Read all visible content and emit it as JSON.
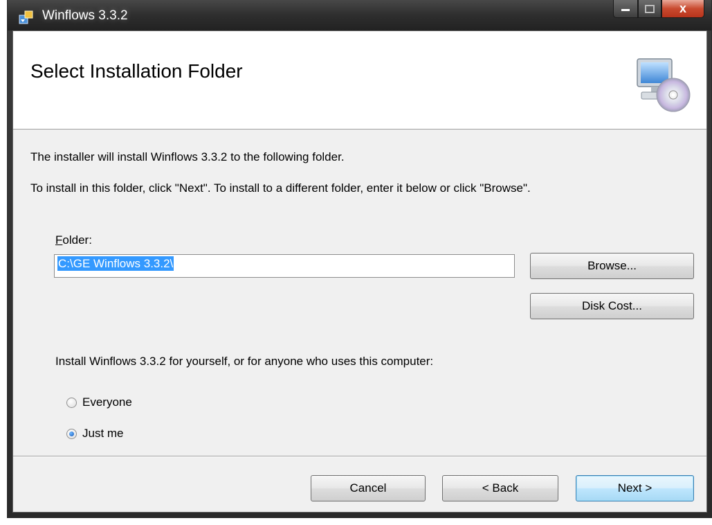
{
  "window": {
    "title": "Winflows 3.3.2",
    "controls": {
      "minimize": "minimize",
      "maximize": "maximize",
      "close": "x"
    }
  },
  "banner": {
    "title": "Select Installation Folder",
    "icon": "computer-cd-icon"
  },
  "messages": {
    "line1": "The installer will install Winflows 3.3.2 to the following folder.",
    "line2": "To install in this folder, click \"Next\". To install to a different folder, enter it below or click \"Browse\"."
  },
  "folder": {
    "label_accel": "F",
    "label_rest": "older:",
    "value": "C:\\GE Winflows 3.3.2\\"
  },
  "buttons": {
    "browse": "Browse...",
    "disk_cost": "Disk Cost...",
    "cancel": "Cancel",
    "back": "< Back",
    "next": "Next >"
  },
  "install_for": {
    "prompt": "Install Winflows 3.3.2 for yourself, or for anyone who uses this computer:",
    "options": [
      {
        "label": "Everyone",
        "selected": false
      },
      {
        "label": "Just me",
        "selected": true
      }
    ]
  },
  "colors": {
    "selection": "#3399ff",
    "default_button_border": "#3c7fb1",
    "close_button": "#c94a2f"
  }
}
